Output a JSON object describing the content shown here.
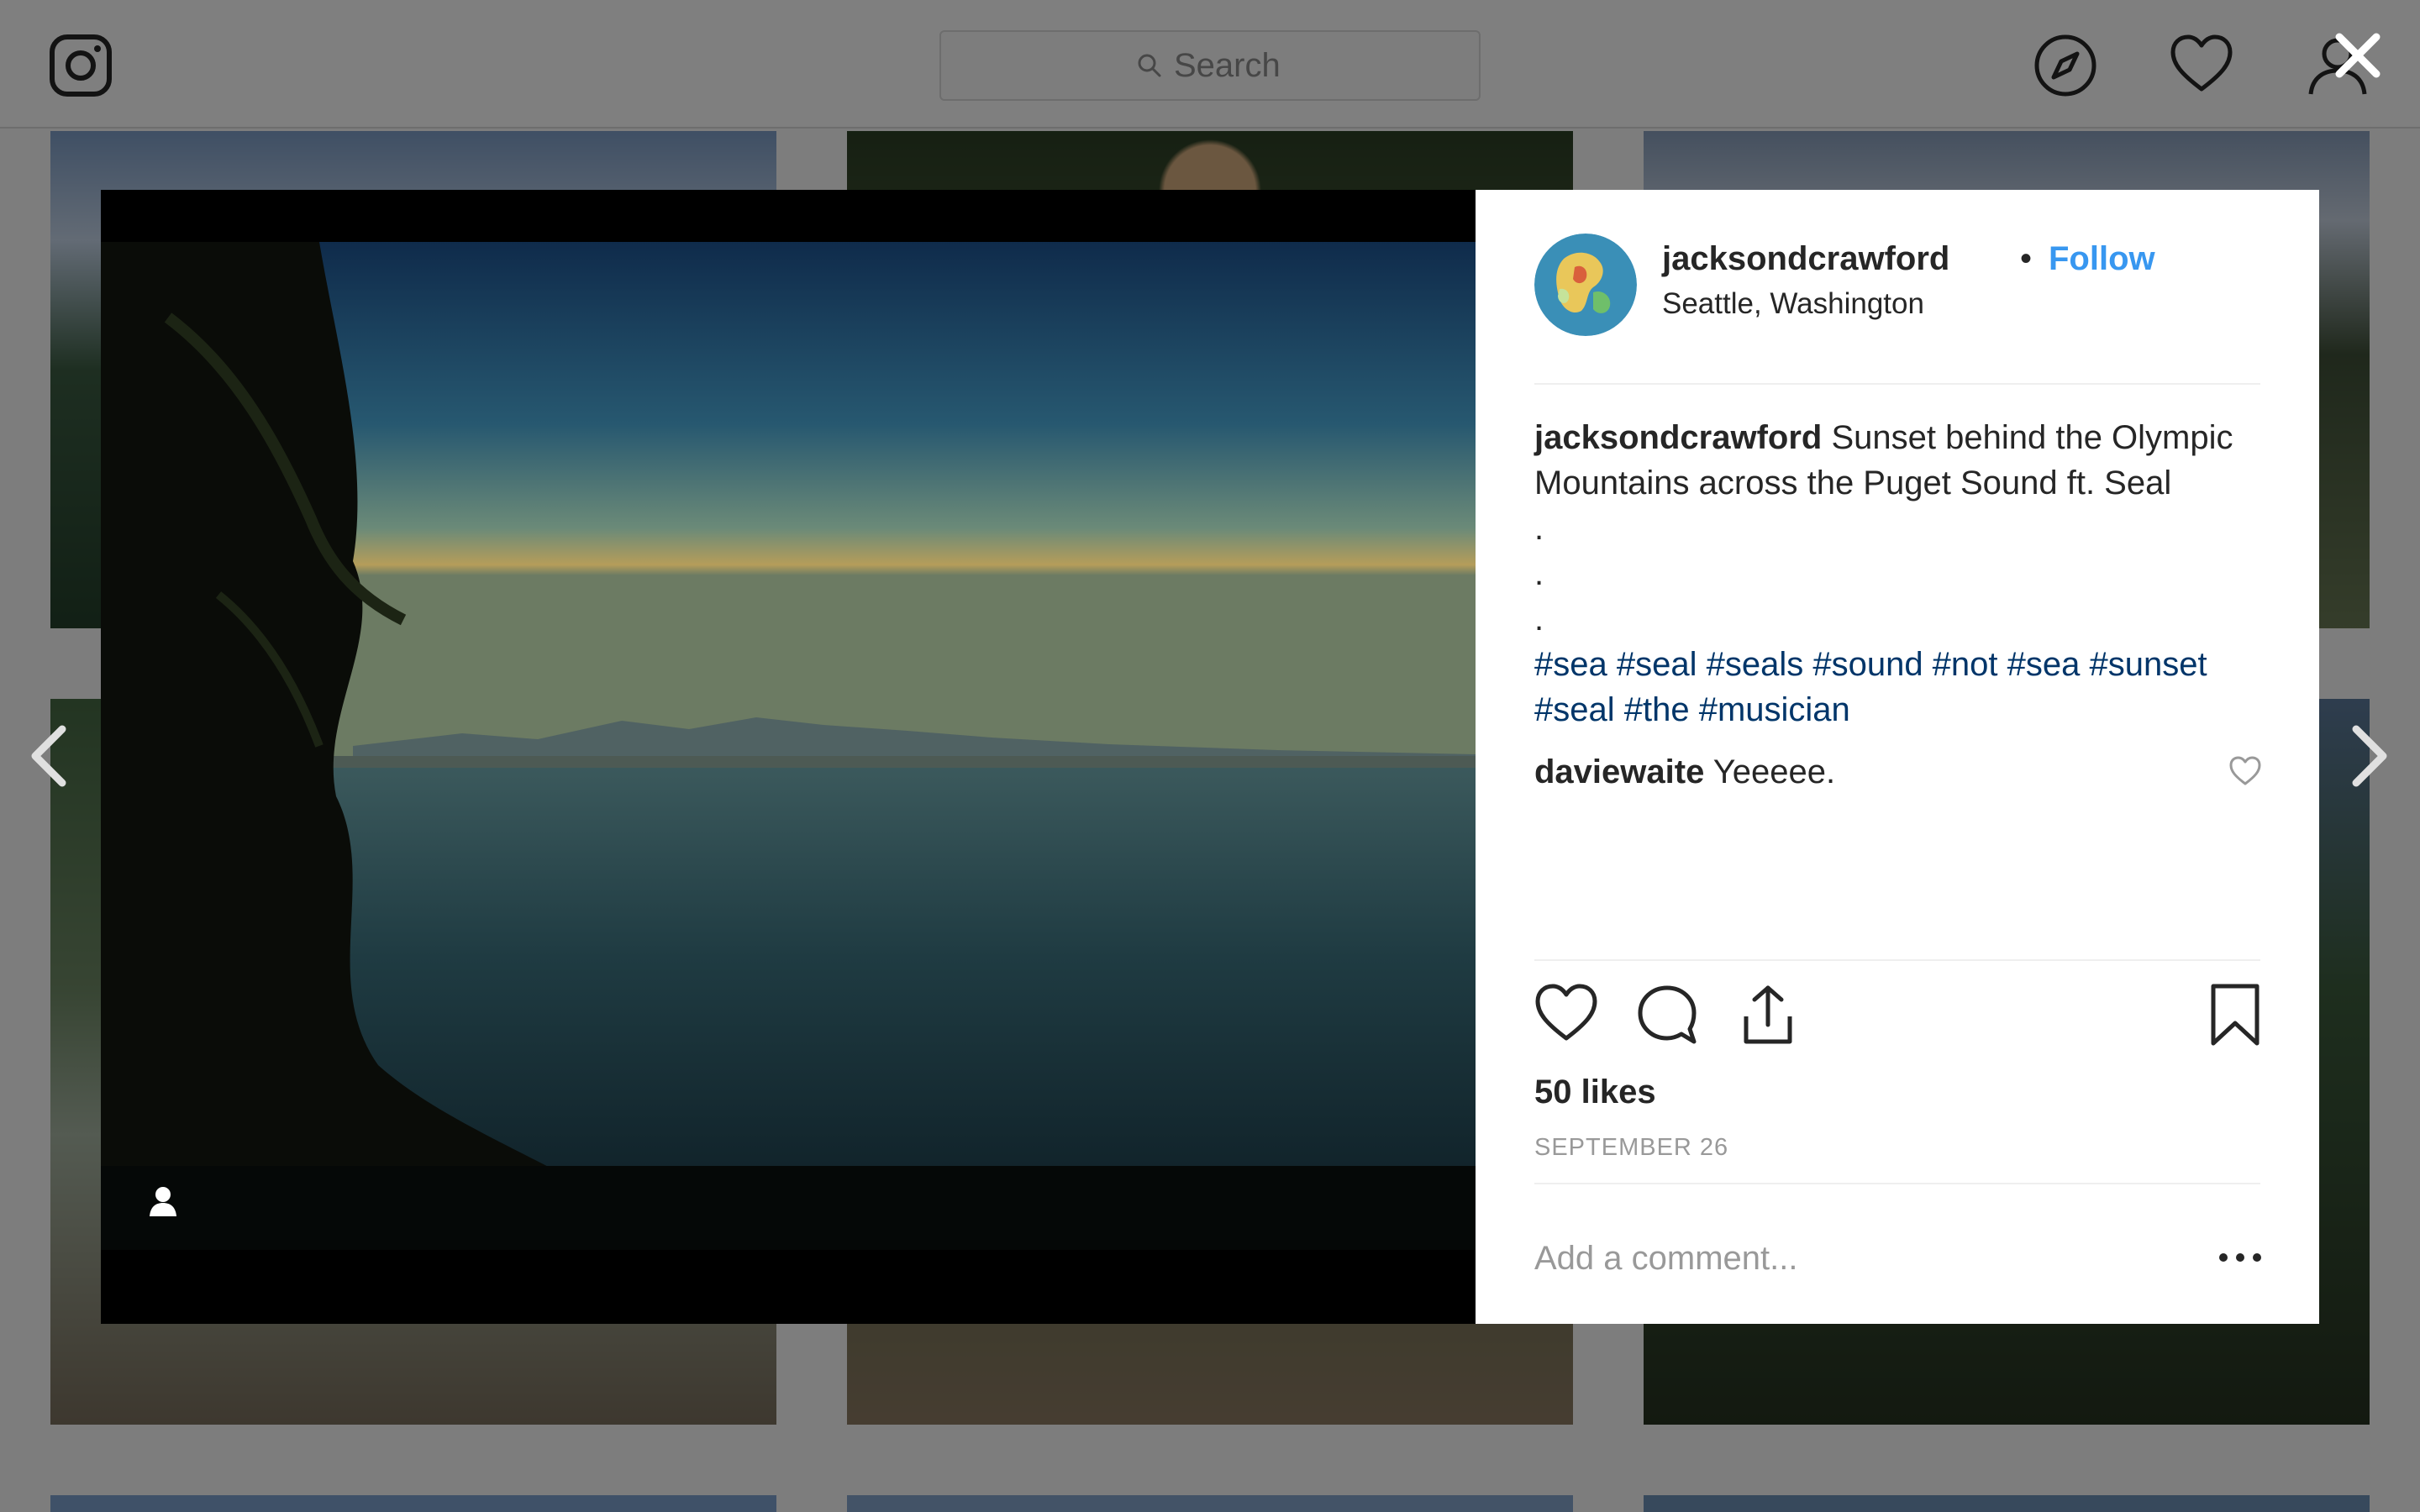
{
  "search": {
    "placeholder": "Search"
  },
  "post": {
    "username": "jacksondcrawford",
    "separator": "•",
    "follow_label": "Follow",
    "location": "Seattle, Washington",
    "caption_text": "Sunset behind the Olympic Mountains across the Puget Sound ft. Seal",
    "caption_dots": [
      ".",
      ".",
      "."
    ],
    "hashtags": "#sea #seal #seals #sound #not #sea #sunset #seal #the #musician",
    "likes": "50 likes",
    "date": "SEPTEMBER 26"
  },
  "comments": [
    {
      "username": "daviewaite",
      "text": "Yeeeee."
    }
  ],
  "comment_input": {
    "placeholder": "Add a comment..."
  },
  "colors": {
    "follow": "#3897f0",
    "hashtag": "#003569",
    "overlay": "rgba(0,0,0,0.5)"
  },
  "icons": {
    "logo": "instagram-logo-icon",
    "explore": "compass-icon",
    "activity": "heart-icon",
    "profile": "user-icon",
    "close": "close-icon",
    "prev": "chevron-left-icon",
    "next": "chevron-right-icon",
    "tag": "user-tag-icon",
    "like": "heart-icon",
    "comment": "comment-bubble-icon",
    "share": "share-icon",
    "save": "bookmark-icon",
    "more": "more-options-icon"
  }
}
